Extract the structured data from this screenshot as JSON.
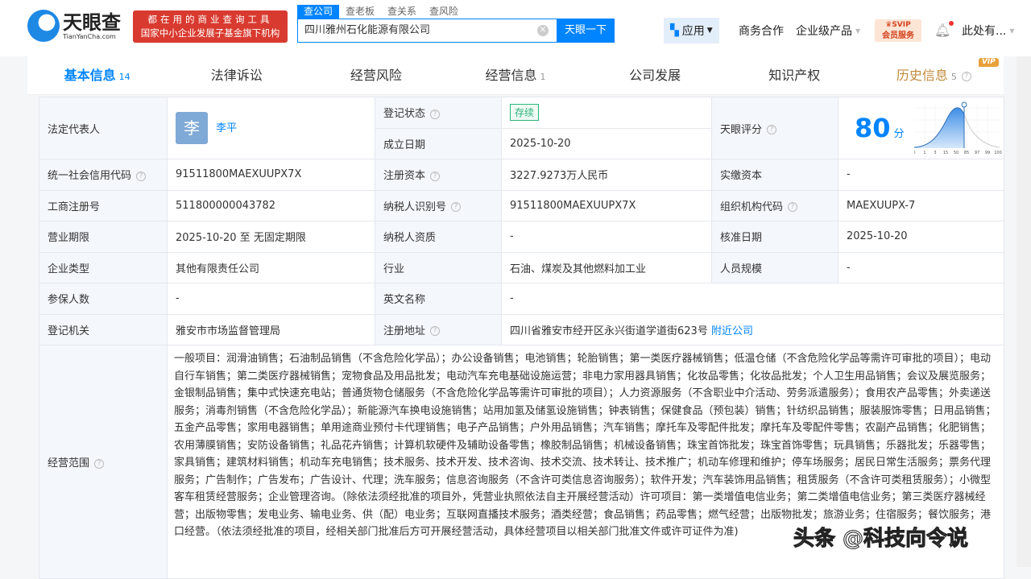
{
  "header": {
    "logo_cn": "天眼查",
    "logo_en": "TianYanCha.com",
    "slogan_1": "都在用的商业查询工具",
    "slogan_2": "国家中小企业发展子基金旗下机构",
    "search_tabs": [
      "查公司",
      "查老板",
      "查关系",
      "查风险"
    ],
    "search_value": "四川雅州石化能源有限公司",
    "search_button": "天眼一下",
    "nav": {
      "apps": "应用",
      "business": "商务合作",
      "enterprise": "企业级产品",
      "svip_1": "SVIP",
      "svip_2": "会员服务",
      "user": "此处有..."
    }
  },
  "tabs": [
    {
      "label": "基本信息",
      "count": "14"
    },
    {
      "label": "法律诉讼"
    },
    {
      "label": "经营风险"
    },
    {
      "label": "经营信息",
      "count": "1"
    },
    {
      "label": "公司发展"
    },
    {
      "label": "知识产权"
    },
    {
      "label": "历史信息",
      "count": "5",
      "badge": "VIP"
    }
  ],
  "info": {
    "legal_rep_label": "法定代表人",
    "legal_rep_avatar": "李",
    "legal_rep": "李平",
    "status_label": "登记状态",
    "status": "存续",
    "founded_label": "成立日期",
    "founded": "2025-10-20",
    "score_label": "天眼评分",
    "score": "80",
    "score_unit": "分",
    "score_ticks": [
      "0",
      "1",
      "3",
      "15",
      "50",
      "85",
      "97",
      "99",
      "100"
    ],
    "credit_code_label": "统一社会信用代码",
    "credit_code": "91511800MAEXUUPX7X",
    "reg_capital_label": "注册资本",
    "reg_capital": "3227.9273万人民币",
    "paid_capital_label": "实缴资本",
    "paid_capital": "-",
    "reg_no_label": "工商注册号",
    "reg_no": "511800000043782",
    "taxpayer_id_label": "纳税人识别号",
    "taxpayer_id": "91511800MAEXUUPX7X",
    "org_code_label": "组织机构代码",
    "org_code": "MAEXUUPX-7",
    "term_label": "营业期限",
    "term": "2025-10-20 至 无固定期限",
    "taxpayer_q_label": "纳税人资质",
    "taxpayer_q": "-",
    "approval_label": "核准日期",
    "approval": "2025-10-20",
    "type_label": "企业类型",
    "type": "其他有限责任公司",
    "industry_label": "行业",
    "industry": "石油、煤炭及其他燃料加工业",
    "staff_label": "人员规模",
    "staff": "-",
    "insured_label": "参保人数",
    "insured": "-",
    "en_name_label": "英文名称",
    "en_name": "-",
    "authority_label": "登记机关",
    "authority": "雅安市市场监督管理局",
    "address_label": "注册地址",
    "address": "四川省雅安市经开区永兴街道学道街623号",
    "nearby": "附近公司",
    "scope_label": "经营范围",
    "scope": "一般项目：润滑油销售；石油制品销售（不含危险化学品）；办公设备销售；电池销售；轮胎销售；第一类医疗器械销售；低温仓储（不含危险化学品等需许可审批的项目）；电动自行车销售；第二类医疗器械销售；宠物食品及用品批发；电动汽车充电基础设施运营；非电力家用器具销售；化妆品零售；化妆品批发；个人卫生用品销售；会议及展览服务；金银制品销售；集中式快速充电站；普通货物仓储服务（不含危险化学品等需许可审批的项目）；人力资源服务（不含职业中介活动、劳务派遣服务）；食用农产品零售；外卖递送服务；消毒剂销售（不含危险化学品）；新能源汽车换电设施销售；站用加氢及储氢设施销售；钟表销售；保健食品（预包装）销售；针纺织品销售；服装服饰零售；日用品销售；五金产品零售；家用电器销售；单用途商业预付卡代理销售；电子产品销售；户外用品销售；汽车销售；摩托车及零配件批发；摩托车及零配件零售；农副产品销售；化肥销售；农用薄膜销售；安防设备销售；礼品花卉销售；计算机软硬件及辅助设备零售；橡胶制品销售；机械设备销售；珠宝首饰批发；珠宝首饰零售；玩具销售；乐器批发；乐器零售；家具销售；建筑材料销售；机动车充电销售；技术服务、技术开发、技术咨询、技术交流、技术转让、技术推广；机动车修理和维护；停车场服务；居民日常生活服务；票务代理服务；广告制作；广告发布；广告设计、代理；洗车服务；信息咨询服务（不含许可类信息咨询服务）；软件开发；汽车装饰用品销售；租赁服务（不含许可类租赁服务）；小微型客车租赁经营服务；企业管理咨询。（除依法须经批准的项目外，凭营业执照依法自主开展经营活动）许可项目：第一类增值电信业务；第二类增值电信业务；第三类医疗器械经营；出版物零售；发电业务、输电业务、供（配）电业务；互联网直播技术服务；酒类经营；食品销售；药品零售；燃气经营；出版物批发；旅游业务；住宿服务；餐饮服务；港口经营。（依法须经批准的项目，经相关部门批准后方可开展经营活动，具体经营项目以相关部门批准文件或许可证件为准)"
  },
  "watermark": "头条 @科技向令说",
  "colors": {
    "accent": "#0084ff",
    "slogan": "#d93a2f",
    "status": "#2cb37a"
  }
}
